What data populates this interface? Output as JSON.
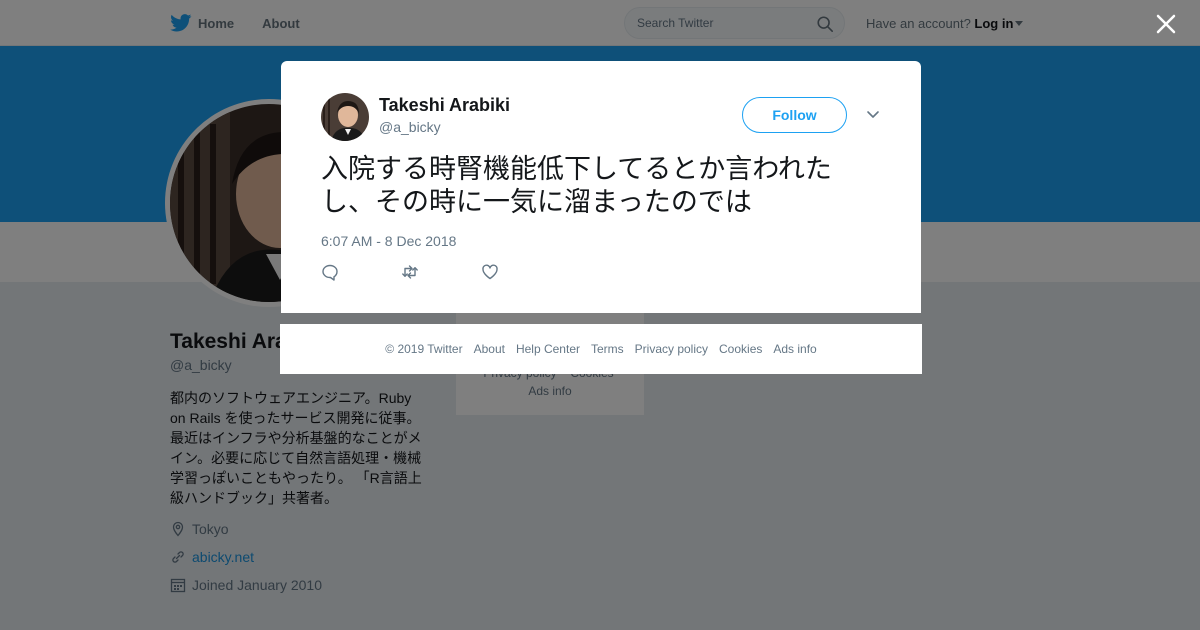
{
  "nav": {
    "home": "Home",
    "about": "About",
    "search_placeholder": "Search Twitter",
    "account_prompt": "Have an account?",
    "login": "Log in"
  },
  "profile": {
    "name": "Takeshi Arabiki",
    "handle": "@a_bicky",
    "bio": "都内のソフトウェアエンジニア。Ruby on Rails を使ったサービス開発に従事。最近はインフラや分析基盤的なことがメイン。必要に応じて自然言語処理・機械学習っぽいこともやったり。 「R言語上級ハンドブック」共著者。",
    "location": "Tokyo",
    "website": "abicky.net",
    "joined": "Joined January 2010",
    "sidebar_lines": [
      "Privacy policy",
      "Cookies",
      "Ads info"
    ]
  },
  "tweet": {
    "name": "Takeshi Arabiki",
    "handle": "@a_bicky",
    "follow_label": "Follow",
    "text": "入院する時腎機能低下してるとか言われたし、その時に一気に溜まったのでは",
    "timestamp": "6:07 AM - 8 Dec 2018"
  },
  "footer": {
    "items": [
      "© 2019 Twitter",
      "About",
      "Help Center",
      "Terms",
      "Privacy policy",
      "Cookies",
      "Ads info"
    ]
  },
  "colors": {
    "brand_blue": "#1da1f2",
    "link_blue": "#1b95e0",
    "secondary_text": "#657786",
    "overlay": "rgba(0,0,0,0.5)"
  },
  "icons": [
    "twitter-bird-icon",
    "search-icon",
    "close-icon",
    "chevron-down-icon",
    "reply-icon",
    "retweet-icon",
    "like-icon",
    "location-icon",
    "link-icon",
    "calendar-icon"
  ]
}
